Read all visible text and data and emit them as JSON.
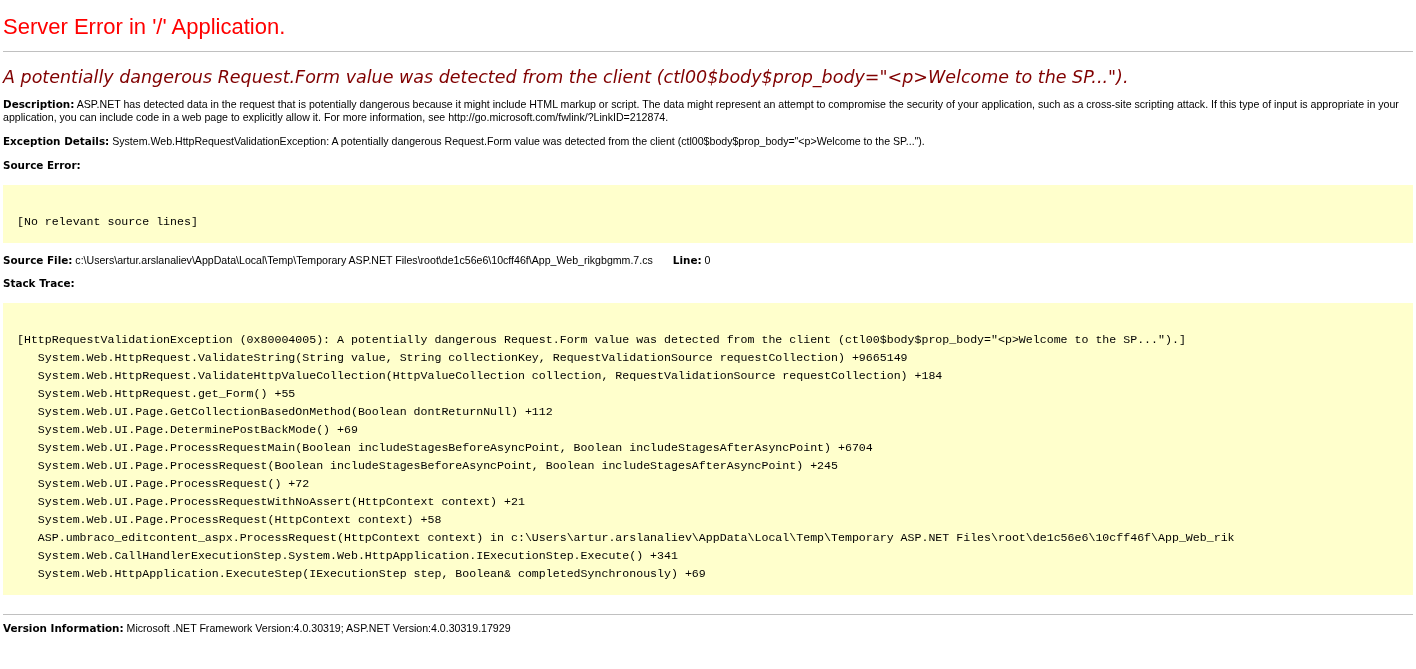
{
  "title": "Server Error in '/' Application.",
  "heading": "A potentially dangerous Request.Form value was detected from the client (ctl00$body$prop_body=\"<p>Welcome to the SP...\").",
  "sections": [
    {
      "kind": "paragraph",
      "text": "**Description:** ASP.NET has detected data in the request that is potentially dangerous because it might include HTML markup or script. The data might represent an attempt to compromise the security of your application, such as a cross-site scripting attack. If this type of input is appropriate in your application, you can include code in a web page to explicitly allow it. For more information, see http://go.microsoft.com/fwlink/?LinkID=212874."
    },
    {
      "kind": "paragraph",
      "text": "**Exception Details:** System.Web.HttpRequestValidationException: A potentially dangerous Request.Form value was detected from the client (ctl00$body$prop_body=\"<p>Welcome to the SP...\")."
    },
    {
      "kind": "label",
      "text": "Source Error:"
    },
    {
      "kind": "code",
      "lines": [
        "[No relevant source lines]"
      ]
    },
    {
      "kind": "file",
      "text": "**Source File:** c:\\Users\\artur.arslanaliev\\AppData\\Local\\Temp\\Temporary ASP.NET Files\\root\\de1c56e6\\10cff46f\\App_Web_rikgbgmm.7.cs",
      "line": "**Line:** 0"
    },
    {
      "kind": "label",
      "text": "Stack Trace:"
    },
    {
      "kind": "code",
      "lines": [
        "[HttpRequestValidationException (0x80004005): A potentially dangerous Request.Form value was detected from the client (ctl00$body$prop_body=\"<p>Welcome to the SP...\").]",
        "   System.Web.HttpRequest.ValidateString(String value, String collectionKey, RequestValidationSource requestCollection) +9665149",
        "   System.Web.HttpRequest.ValidateHttpValueCollection(HttpValueCollection collection, RequestValidationSource requestCollection) +184",
        "   System.Web.HttpRequest.get_Form() +55",
        "   System.Web.UI.Page.GetCollectionBasedOnMethod(Boolean dontReturnNull) +112",
        "   System.Web.UI.Page.DeterminePostBackMode() +69",
        "   System.Web.UI.Page.ProcessRequestMain(Boolean includeStagesBeforeAsyncPoint, Boolean includeStagesAfterAsyncPoint) +6704",
        "   System.Web.UI.Page.ProcessRequest(Boolean includeStagesBeforeAsyncPoint, Boolean includeStagesAfterAsyncPoint) +245",
        "   System.Web.UI.Page.ProcessRequest() +72",
        "   System.Web.UI.Page.ProcessRequestWithNoAssert(HttpContext context) +21",
        "   System.Web.UI.Page.ProcessRequest(HttpContext context) +58",
        "   ASP.umbraco_editcontent_aspx.ProcessRequest(HttpContext context) in c:\\Users\\artur.arslanaliev\\AppData\\Local\\Temp\\Temporary ASP.NET Files\\root\\de1c56e6\\10cff46f\\App_Web_rik",
        "   System.Web.CallHandlerExecutionStep.System.Web.HttpApplication.IExecutionStep.Execute() +341",
        "   System.Web.HttpApplication.ExecuteStep(IExecutionStep step, Boolean& completedSynchronously) +69"
      ]
    }
  ],
  "version": "**Version Information:** Microsoft .NET Framework Version:4.0.30319; ASP.NET Version:4.0.30319.17929"
}
